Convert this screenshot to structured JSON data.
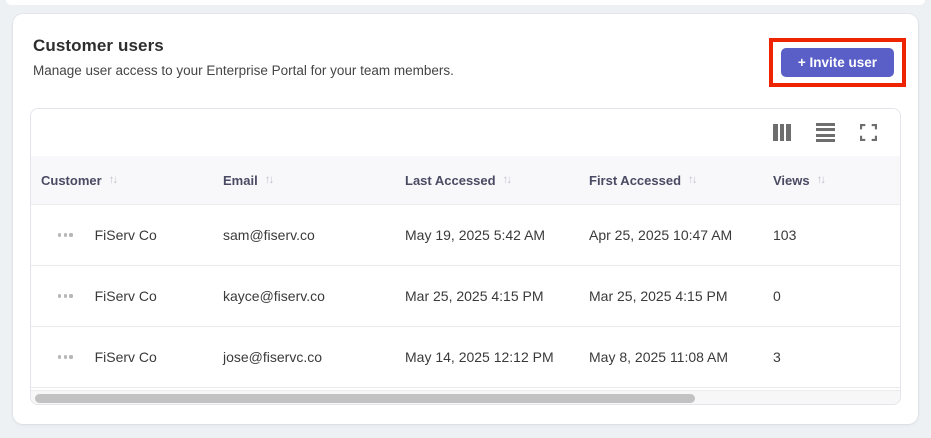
{
  "page": {
    "title": "Customer users",
    "subtitle": "Manage user access to your Enterprise Portal for your team members."
  },
  "actions": {
    "invite_label": "+ Invite user"
  },
  "annotation": {
    "type": "highlight-box",
    "color": "#ee2400",
    "target": "invite-user-button"
  },
  "colors": {
    "accent": "#5a5fc8",
    "page_bg": "#edf1f4",
    "table_header_bg": "#f8f8fb",
    "highlight_red": "#ee2400"
  },
  "icons": {
    "columns_view": "three-vertical-bars",
    "list_view": "four-horizontal-lines",
    "fullscreen": "corner-brackets",
    "row_menu": "horizontal-ellipsis",
    "sort": "↑↓"
  },
  "table": {
    "columns": [
      {
        "label": "Customer",
        "sortable": true
      },
      {
        "label": "Email",
        "sortable": true
      },
      {
        "label": "Last Accessed",
        "sortable": true
      },
      {
        "label": "First Accessed",
        "sortable": true
      },
      {
        "label": "Views",
        "sortable": true
      }
    ],
    "rows": [
      {
        "customer": "FiServ Co",
        "email": "sam@fiserv.co",
        "last_accessed": "May 19, 2025 5:42 AM",
        "first_accessed": "Apr 25, 2025 10:47 AM",
        "views": "103"
      },
      {
        "customer": "FiServ Co",
        "email": "kayce@fiserv.co",
        "last_accessed": "Mar 25, 2025 4:15 PM",
        "first_accessed": "Mar 25, 2025 4:15 PM",
        "views": "0"
      },
      {
        "customer": "FiServ Co",
        "email": "jose@fiservc.co",
        "last_accessed": "May 14, 2025 12:12 PM",
        "first_accessed": "May 8, 2025 11:08 AM",
        "views": "3"
      }
    ],
    "hscrollbar": {
      "thumb_fraction": 0.76
    }
  }
}
